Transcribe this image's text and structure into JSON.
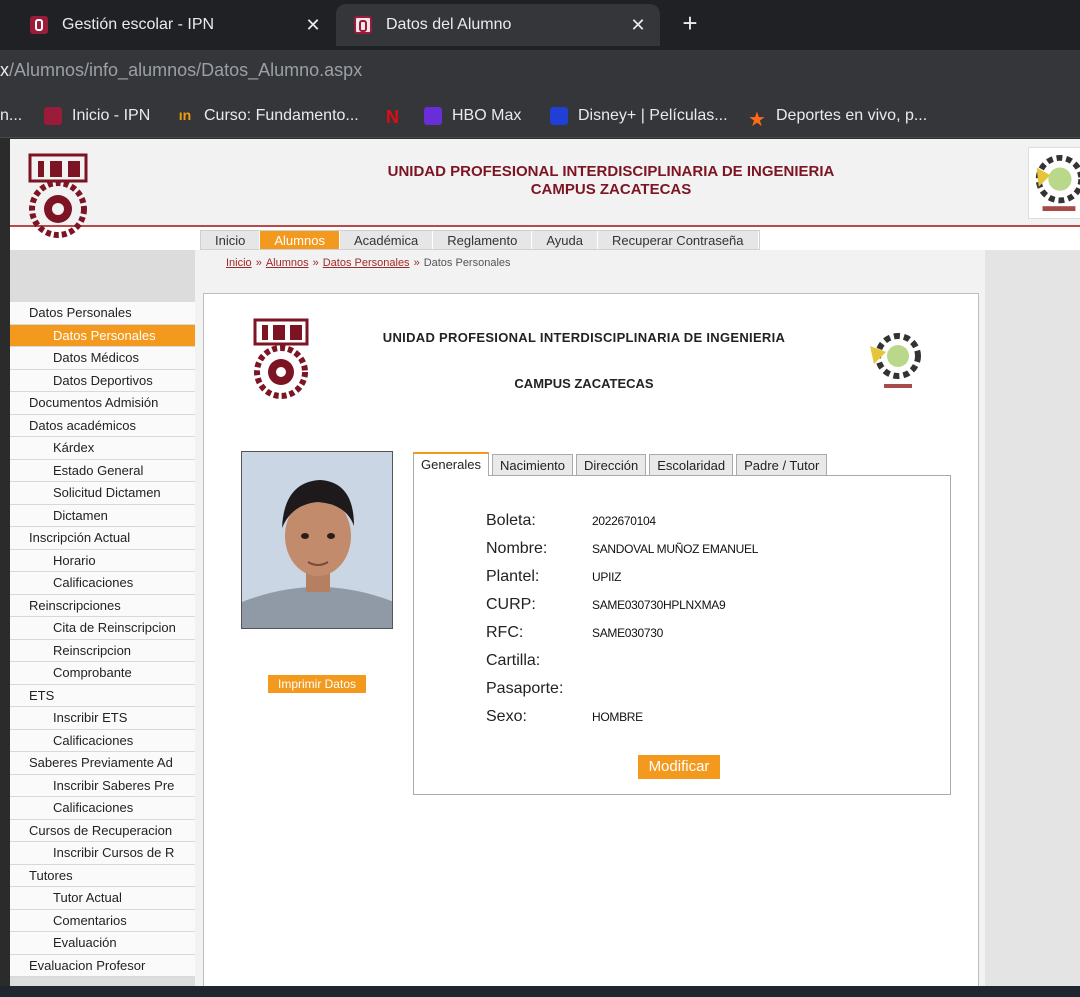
{
  "browser": {
    "tabs": [
      {
        "title": "Gestión escolar - IPN",
        "close": "✕"
      },
      {
        "title": "Datos del Alumno",
        "close": "✕"
      }
    ],
    "new_tab": "+",
    "url_highlight": "x",
    "url_rest": "/Alumnos/info_alumnos/Datos_Alumno.aspx",
    "bookmarks": [
      {
        "label": "n...",
        "icon": "none"
      },
      {
        "label": "Inicio - IPN",
        "icon": "ipn-icon"
      },
      {
        "label": "Curso: Fundamento...",
        "icon": "curso-icon"
      },
      {
        "label": "HBO Max",
        "icon": "hbo-icon"
      },
      {
        "label": "Disney+ | Películas...",
        "icon": "disney-icon"
      },
      {
        "label": "Deportes en vivo, p...",
        "icon": "star-icon"
      }
    ],
    "bookmark_glyphs": {
      "curso": "ın",
      "netflix": "N",
      "star": "★"
    }
  },
  "header": {
    "title_line1": "UNIDAD PROFESIONAL INTERDISCIPLINARIA DE INGENIERIA",
    "title_line2": "CAMPUS ZACATECAS"
  },
  "menu": [
    "Inicio",
    "Alumnos",
    "Académica",
    "Reglamento",
    "Ayuda",
    "Recuperar Contraseña"
  ],
  "menu_active": "Alumnos",
  "breadcrumb": {
    "links": [
      "Inicio",
      "Alumnos",
      "Datos Personales"
    ],
    "separator": "»",
    "current": "Datos Personales"
  },
  "sidebar": [
    {
      "label": "Datos Personales",
      "child": false
    },
    {
      "label": "Datos Personales",
      "child": true,
      "active": true
    },
    {
      "label": "Datos Médicos",
      "child": true
    },
    {
      "label": "Datos Deportivos",
      "child": true
    },
    {
      "label": "Documentos Admisión",
      "child": false
    },
    {
      "label": "Datos académicos",
      "child": false
    },
    {
      "label": "Kárdex",
      "child": true
    },
    {
      "label": "Estado General",
      "child": true
    },
    {
      "label": "Solicitud Dictamen",
      "child": true
    },
    {
      "label": "Dictamen",
      "child": true
    },
    {
      "label": "Inscripción Actual",
      "child": false
    },
    {
      "label": "Horario",
      "child": true
    },
    {
      "label": "Calificaciones",
      "child": true
    },
    {
      "label": "Reinscripciones",
      "child": false
    },
    {
      "label": "Cita de Reinscripcion",
      "child": true
    },
    {
      "label": "Reinscripcion",
      "child": true
    },
    {
      "label": "Comprobante",
      "child": true
    },
    {
      "label": "ETS",
      "child": false
    },
    {
      "label": "Inscribir ETS",
      "child": true
    },
    {
      "label": "Calificaciones",
      "child": true
    },
    {
      "label": "Saberes Previamente Ad",
      "child": false
    },
    {
      "label": "Inscribir Saberes Pre",
      "child": true
    },
    {
      "label": "Calificaciones",
      "child": true
    },
    {
      "label": "Cursos de Recuperacion",
      "child": false
    },
    {
      "label": "Inscribir Cursos de R",
      "child": true
    },
    {
      "label": "Tutores",
      "child": false
    },
    {
      "label": "Tutor Actual",
      "child": true
    },
    {
      "label": "Comentarios",
      "child": true
    },
    {
      "label": "Evaluación",
      "child": true
    },
    {
      "label": "Evaluacion Profesor",
      "child": false
    }
  ],
  "card": {
    "title_line1": "UNIDAD PROFESIONAL INTERDISCIPLINARIA DE INGENIERIA",
    "title_line2": "CAMPUS ZACATECAS",
    "print_button": "Imprimir Datos",
    "modify_button": "Modificar",
    "tabs": [
      "Generales",
      "Nacimiento",
      "Dirección",
      "Escolaridad",
      "Padre / Tutor"
    ],
    "active_tab": "Generales",
    "fields": [
      {
        "label": "Boleta:",
        "value": "2022670104"
      },
      {
        "label": "Nombre:",
        "value": "SANDOVAL MUÑOZ EMANUEL"
      },
      {
        "label": "Plantel:",
        "value": "UPIIZ"
      },
      {
        "label": "CURP:",
        "value": "SAME030730HPLNXMA9"
      },
      {
        "label": "RFC:",
        "value": "SAME030730"
      },
      {
        "label": "Cartilla:",
        "value": ""
      },
      {
        "label": "Pasaporte:",
        "value": ""
      },
      {
        "label": "Sexo:",
        "value": "HOMBRE"
      }
    ]
  },
  "colors": {
    "accent": "#f39a1e",
    "brand": "#7c1424",
    "chrome_dark": "#202124",
    "chrome_mid": "#35363a"
  }
}
